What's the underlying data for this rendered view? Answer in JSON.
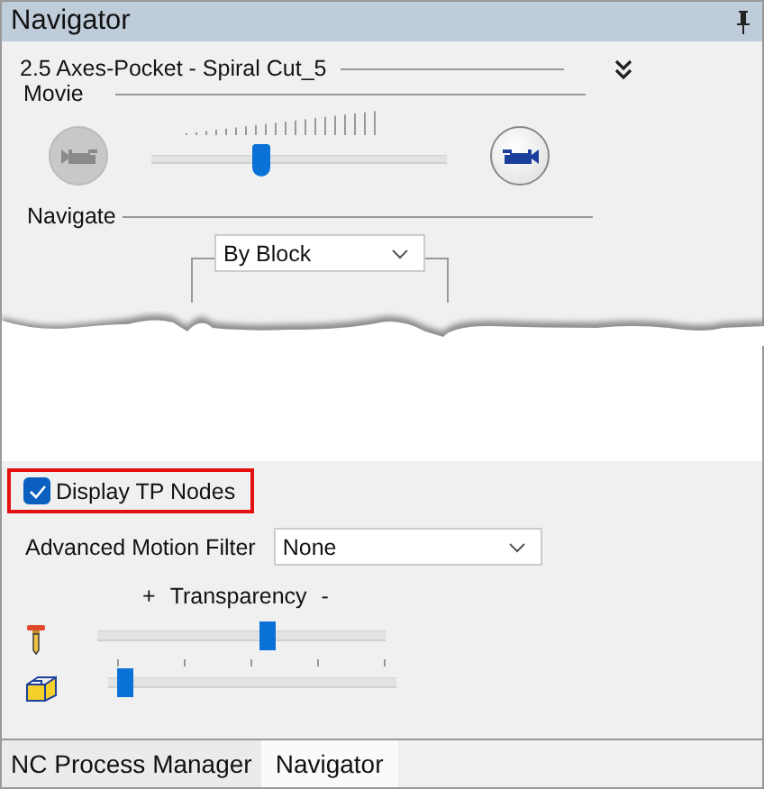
{
  "window": {
    "title": "Navigator"
  },
  "operation": {
    "title": "2.5 Axes-Pocket - Spiral Cut_5"
  },
  "movie": {
    "label": "Movie",
    "level": 0.34,
    "buttons": [
      {
        "disabled": true
      },
      {
        "disabled": false
      }
    ]
  },
  "navigate": {
    "label": "Navigate",
    "mode": "By Block"
  },
  "display_tp_nodes": {
    "label": "Display TP Nodes",
    "checked": true
  },
  "motion_filter": {
    "label": "Advanced Motion Filter",
    "value": "None"
  },
  "transparency": {
    "plus": "+",
    "label": "Transparency",
    "minus": "-",
    "sliders": [
      {
        "kind": "tool",
        "level": 0.59
      },
      {
        "kind": "stock",
        "level": 0.03
      }
    ]
  },
  "tabs": [
    {
      "label": "NC Process Manager",
      "selected": false
    },
    {
      "label": "Navigator",
      "selected": true
    }
  ]
}
